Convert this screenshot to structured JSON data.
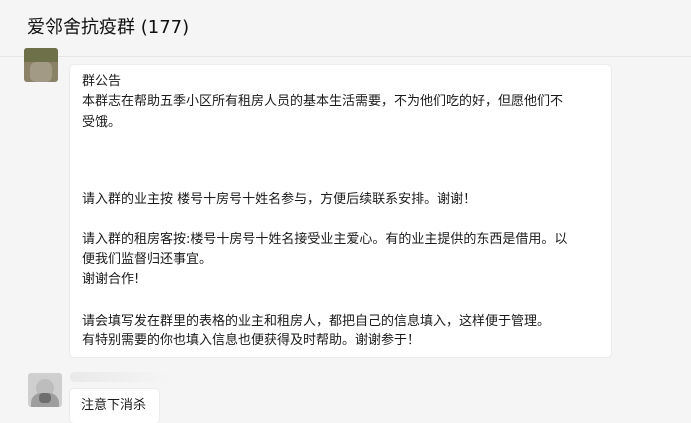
{
  "header": {
    "title": "爱邻舍抗疫群 (177)"
  },
  "notice": {
    "heading": "群公告",
    "lines": [
      "本群志在帮助五季小区所有租房人员的基本生活需要，不为他们吃的好，但愿他们不",
      "受饿。",
      "请入群的业主按 楼号十房号十姓名参与，方便后续联系安排。谢谢！",
      "请入群的租房客按:楼号十房号十姓名接受业主爱心。有的业主提供的东西是借用。以",
      "便我们监督归还事宜。",
      "谢谢合作!",
      "请会填写发在群里的表格的业主和租房人，都把自己的信息填入，这样便于管理。",
      "有特别需要的你也填入信息也便获得及时帮助。谢谢参于！"
    ]
  },
  "message": {
    "text": "注意下消杀"
  }
}
